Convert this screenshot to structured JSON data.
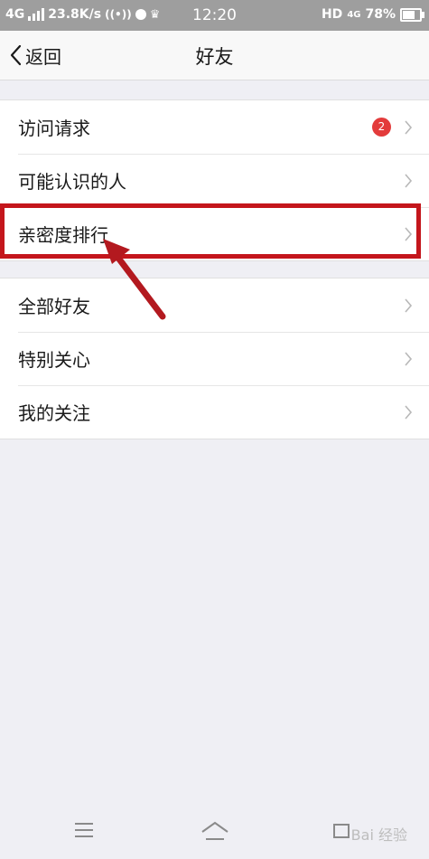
{
  "status_bar": {
    "network_type": "4G",
    "net_speed": "23.8K/s",
    "time": "12:20",
    "hd_label": "HD",
    "network_right": "4G",
    "battery_percent": "78%"
  },
  "nav_bar": {
    "back_label": "返回",
    "title": "好友"
  },
  "groups": [
    {
      "items": [
        {
          "label": "访问请求",
          "badge": "2"
        },
        {
          "label": "可能认识的人"
        },
        {
          "label": "亲密度排行",
          "highlighted": true
        }
      ]
    },
    {
      "items": [
        {
          "label": "全部好友"
        },
        {
          "label": "特别关心"
        },
        {
          "label": "我的关注"
        }
      ]
    }
  ],
  "colors": {
    "highlight_border": "#c4161c",
    "badge": "#e33b3b",
    "background": "#efeff4"
  },
  "watermark": "Bai 经验"
}
